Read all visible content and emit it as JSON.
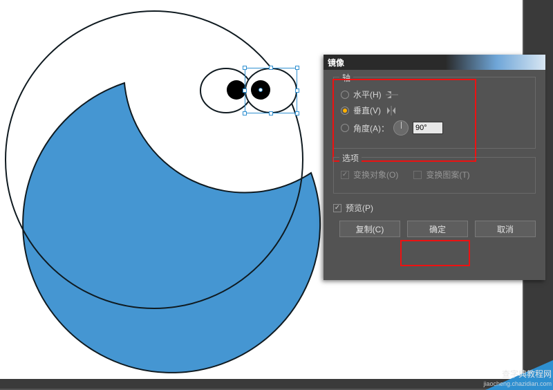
{
  "dialog": {
    "title": "镜像",
    "axis_group": "轴",
    "horizontal": "水平(H)",
    "vertical": "垂直(V)",
    "angle_label": "角度(A)：",
    "angle_value": "90°",
    "options_group": "选项",
    "transform_objects": "变换对象(O)",
    "transform_patterns": "变换图案(T)",
    "preview": "预览(P)",
    "copy_btn": "复制(C)",
    "ok_btn": "确定",
    "cancel_btn": "取消"
  },
  "watermark": {
    "line1": "查字典教程网",
    "line2": "jiaocheng.chazidian.com"
  }
}
